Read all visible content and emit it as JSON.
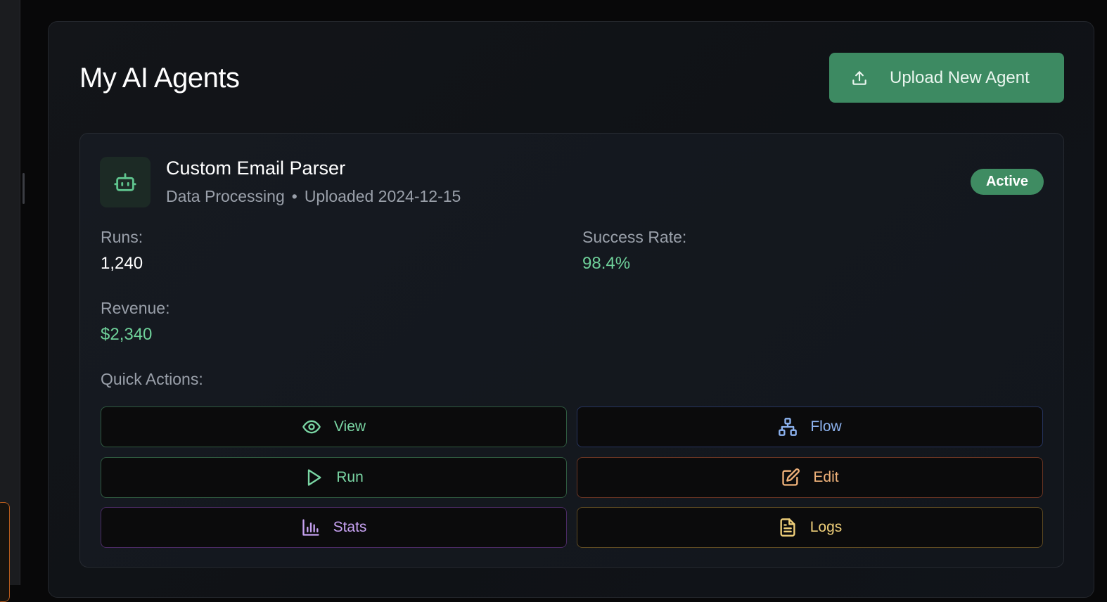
{
  "page": {
    "title": "My AI Agents",
    "upload_button_label": "Upload New Agent"
  },
  "agent": {
    "name": "Custom Email Parser",
    "category": "Data Processing",
    "separator": "•",
    "uploaded": "Uploaded 2024-12-15",
    "status": "Active",
    "stats": {
      "runs_label": "Runs:",
      "runs_value": "1,240",
      "success_label": "Success Rate:",
      "success_value": "98.4%",
      "revenue_label": "Revenue:",
      "revenue_value": "$2,340"
    }
  },
  "quick_actions": {
    "title": "Quick Actions:",
    "view": "View",
    "flow": "Flow",
    "run": "Run",
    "edit": "Edit",
    "stats": "Stats",
    "logs": "Logs"
  },
  "icons": {
    "upload": "upload-icon",
    "agent": "robot-icon",
    "view": "eye-icon",
    "flow": "sitemap-icon",
    "run": "play-icon",
    "edit": "edit-icon",
    "stats": "bar-chart-icon",
    "logs": "file-text-icon"
  },
  "colors": {
    "accent_green": "#3d8a62",
    "success_text": "#6fd19a",
    "flow_blue": "#8db3f0",
    "edit_orange": "#f0b27a",
    "stats_purple": "#c7a2f2",
    "logs_yellow": "#f0d07a"
  }
}
